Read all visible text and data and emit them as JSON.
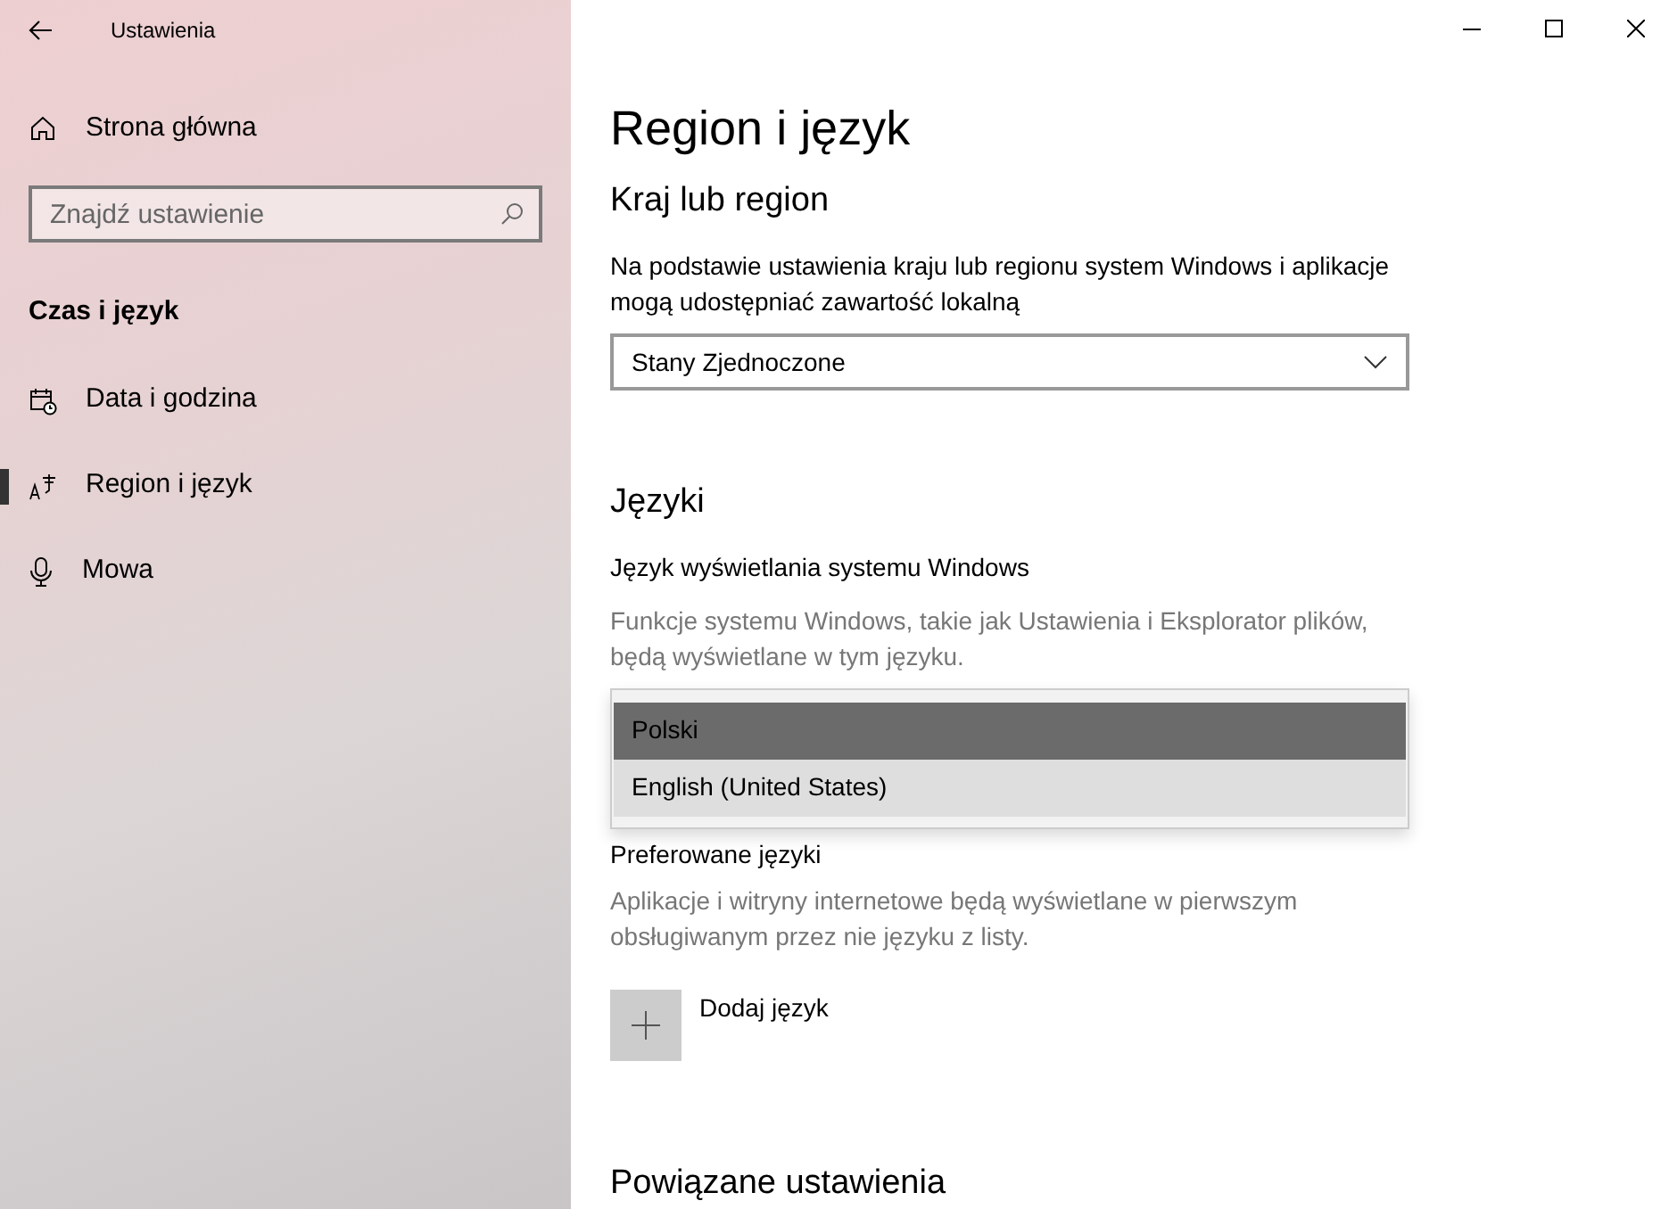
{
  "window": {
    "title": "Ustawienia"
  },
  "sidebar": {
    "home": "Strona główna",
    "search": {
      "placeholder": "Znajdź ustawienie"
    },
    "section": "Czas i język",
    "items": [
      {
        "label": "Data i godzina",
        "kind": "calendar",
        "selected": false
      },
      {
        "label": "Region i język",
        "kind": "language",
        "selected": true
      },
      {
        "label": "Mowa",
        "kind": "microphone",
        "selected": false
      }
    ]
  },
  "page": {
    "title": "Region i język",
    "country": {
      "heading": "Kraj lub region",
      "description": "Na podstawie ustawienia kraju lub regionu system Windows i aplikacje mogą udostępniać zawartość lokalną",
      "value": "Stany Zjednoczone"
    },
    "languages": {
      "heading": "Języki",
      "display_label": "Język wyświetlania systemu Windows",
      "display_description": "Funkcje systemu Windows, takie jak Ustawienia i Eksplorator plików, będą wyświetlane w tym języku.",
      "display_options": [
        {
          "label": "Polski",
          "selected": true,
          "hovered": false
        },
        {
          "label": "English (United States)",
          "selected": false,
          "hovered": true
        }
      ],
      "preferred_label": "Preferowane języki",
      "preferred_description": "Aplikacje i witryny internetowe będą wyświetlane w pierwszym obsługiwanym przez nie języku z listy.",
      "add_button": "Dodaj język"
    },
    "related": {
      "heading": "Powiązane ustawienia"
    }
  }
}
